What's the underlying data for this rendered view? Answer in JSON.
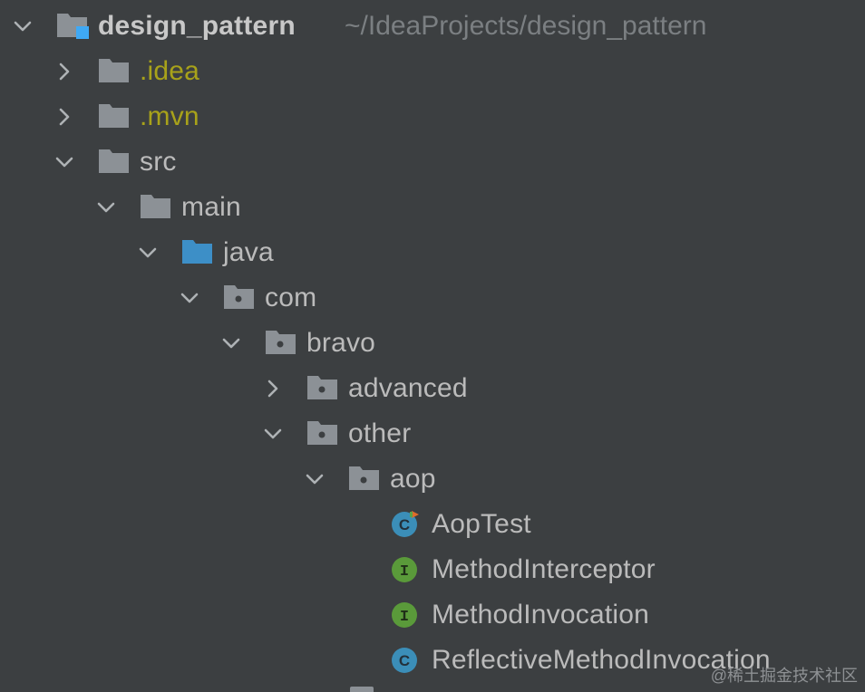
{
  "colors": {
    "background": "#3c3f41",
    "text": "#bbbbbb",
    "excluded_text": "#a8a21a",
    "folder": "#8c9196",
    "source_folder": "#3d8fc7",
    "class_icon": "#3b8eb8",
    "interface_icon": "#5a9a3a",
    "module_marker": "#3fa9f5"
  },
  "project": {
    "name": "design_pattern",
    "path": "~/IdeaProjects/design_pattern"
  },
  "tree": {
    "idea": {
      "label": ".idea",
      "icon": "folder-icon"
    },
    "mvn": {
      "label": ".mvn",
      "icon": "folder-icon"
    },
    "src": {
      "label": "src",
      "icon": "folder-icon"
    },
    "main": {
      "label": "main",
      "icon": "folder-icon"
    },
    "java": {
      "label": "java",
      "icon": "source-folder-icon"
    },
    "com": {
      "label": "com",
      "icon": "package-icon"
    },
    "bravo": {
      "label": "bravo",
      "icon": "package-icon"
    },
    "advanced": {
      "label": "advanced",
      "icon": "package-icon"
    },
    "other": {
      "label": "other",
      "icon": "package-icon"
    },
    "aop": {
      "label": "aop",
      "icon": "package-icon"
    },
    "files": [
      {
        "label": "AopTest",
        "icon": "java-class-runnable-icon",
        "glyph": "C"
      },
      {
        "label": "MethodInterceptor",
        "icon": "java-interface-icon",
        "glyph": "I"
      },
      {
        "label": "MethodInvocation",
        "icon": "java-interface-icon",
        "glyph": "I"
      },
      {
        "label": "ReflectiveMethodInvocation",
        "icon": "java-class-icon",
        "glyph": "C"
      }
    ]
  },
  "watermark": "@稀土掘金技术社区"
}
